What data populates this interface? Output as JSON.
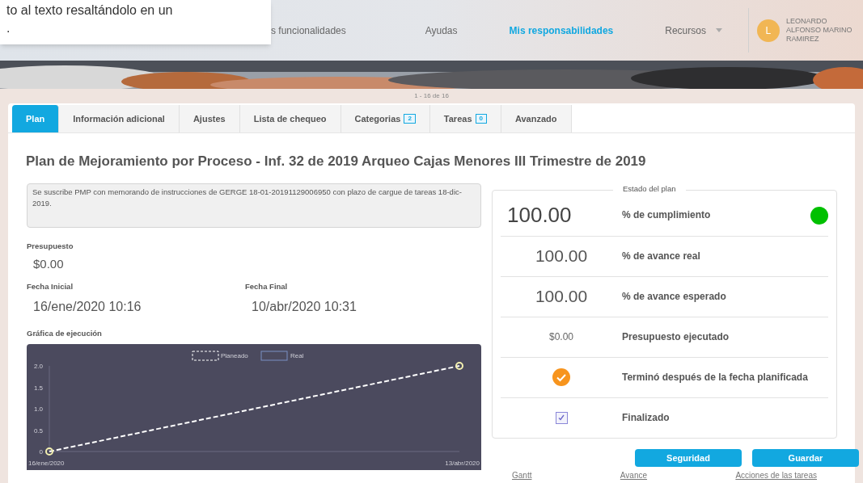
{
  "tooltip": {
    "lines": [
      "to al texto resaltándolo en un",
      "."
    ]
  },
  "nav": {
    "items": [
      {
        "label": "s funcionalidades",
        "selected": false,
        "dropdown": false
      },
      {
        "label": "Ayudas",
        "selected": false,
        "dropdown": false
      },
      {
        "label": "Mis responsabilidades",
        "selected": true,
        "dropdown": false
      },
      {
        "label": "Recursos",
        "selected": false,
        "dropdown": true
      }
    ],
    "user": {
      "initial": "L",
      "name": "LEONARDO ALFONSO MARINO RAMIREZ"
    }
  },
  "pager": "1 - 16 de 16",
  "tabs": [
    {
      "label": "Plan",
      "selected": true
    },
    {
      "label": "Información adicional",
      "selected": false
    },
    {
      "label": "Ajustes",
      "selected": false
    },
    {
      "label": "Lista de chequeo",
      "selected": false
    },
    {
      "label": "Categorias",
      "badge": "2",
      "selected": false
    },
    {
      "label": "Tareas",
      "badge": "0",
      "selected": false
    },
    {
      "label": "Avanzado",
      "selected": false
    }
  ],
  "title": "Plan de Mejoramiento por Proceso - Inf. 32 de 2019 Arqueo Cajas Menores III Trimestre de 2019",
  "description": "Se suscribe PMP con memorando de instrucciones de GERGE 18-01-20191129006950 con plazo de cargue de tareas 18-dic-2019.",
  "budget": {
    "label": "Presupuesto",
    "value": "$0.00"
  },
  "start_date": {
    "label": "Fecha Inicial",
    "value": "16/ene/2020 10:16"
  },
  "end_date": {
    "label": "Fecha Final",
    "value": "10/abr/2020 10:31"
  },
  "chart": {
    "label": "Gráfica de ejecución",
    "chart_data": {
      "type": "line",
      "categories": [
        "16/ene/2020",
        "13/abr/2020"
      ],
      "legend": "top",
      "series": [
        {
          "name": "Real",
          "color": "#7b8fc4",
          "values": [
            null,
            null
          ]
        },
        {
          "name": "Planeado",
          "color": "#ffffff",
          "values": [
            0,
            2
          ],
          "line_style": "dashed",
          "marker": "circle"
        }
      ],
      "ylim": [
        0,
        2
      ],
      "yticks": [
        {
          "value": 0,
          "label": "0"
        },
        {
          "value": 0.5,
          "label": "0.5"
        },
        {
          "value": 1,
          "label": "1.0"
        },
        {
          "value": 1.5,
          "label": "1.5"
        },
        {
          "value": 2,
          "label": "2.0"
        }
      ]
    }
  },
  "status": {
    "title": "Estado del plan",
    "rows": [
      {
        "kind": "number",
        "value": "100.00",
        "label": "% de cumplimiento",
        "large": true,
        "color": "#00c000"
      },
      {
        "kind": "number",
        "value": "100.00",
        "label": "% de avance real",
        "large": false
      },
      {
        "kind": "number",
        "value": "100.00",
        "label": "% de avance esperado",
        "large": false
      },
      {
        "kind": "money",
        "value": "$0.00",
        "label": "Presupuesto ejecutado"
      },
      {
        "kind": "badge",
        "label": "Terminó después de la fecha planificada"
      },
      {
        "kind": "checkbox",
        "label": "Finalizado",
        "checked": true
      }
    ]
  },
  "links": [
    "Gantt",
    "Avance",
    "Acciones de las tareas"
  ],
  "buttons": [
    "Seguridad",
    "Guardar"
  ]
}
